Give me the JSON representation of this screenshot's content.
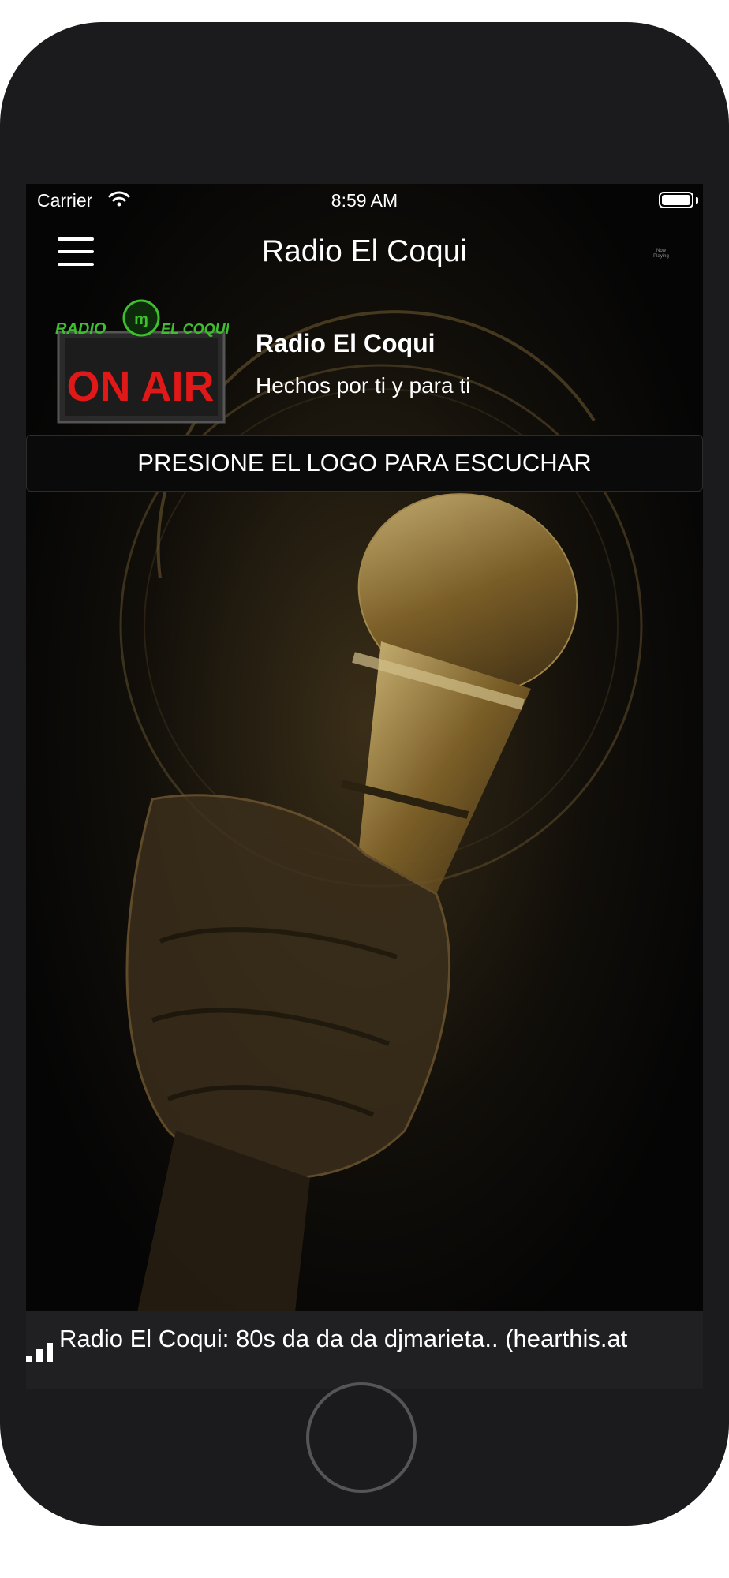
{
  "status_bar": {
    "carrier": "Carrier",
    "time": "8:59 AM"
  },
  "nav": {
    "title": "Radio El Coqui",
    "now_playing_label": "Now Playing"
  },
  "station": {
    "logo_text_top": "RADIO",
    "logo_text_top_right": "EL COQUI",
    "logo_text_sign": "ON AIR",
    "name": "Radio El Coqui",
    "tagline": "Hechos por ti y para ti"
  },
  "banner": {
    "text": "PRESIONE EL LOGO PARA ESCUCHAR"
  },
  "player": {
    "now_playing": "Radio El Coqui: 80s da da da djmarieta.. (hearthis.at"
  },
  "colors": {
    "accent_gold": "#c9a24a",
    "logo_green": "#3fbf2f",
    "onair_red": "#e01818"
  }
}
